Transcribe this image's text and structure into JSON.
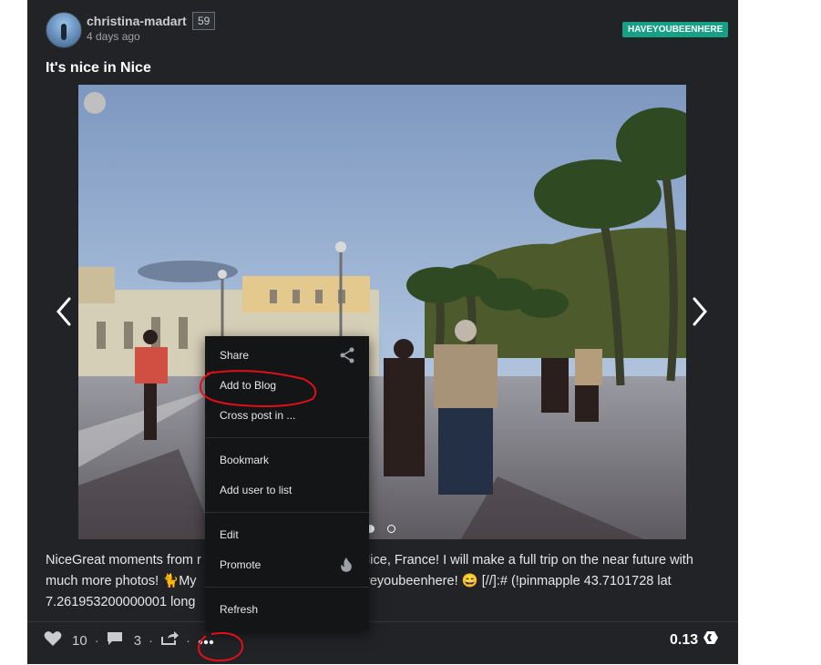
{
  "post": {
    "author": "christina-madart",
    "reputation": "59",
    "timestamp": "4 days ago",
    "tag": "HAVEYOUBEENHERE",
    "title": "It's nice in Nice",
    "body_line1": "NiceGreat moments from r",
    "body_line1_right": "Nice, France! I will make a full trip on the near future with",
    "body_line2": "much more photos! 🐈My",
    "body_line2_right": "aveyoubeenhere! 😄 [//]:# (!pinmapple 43.7101728 lat",
    "body_line3": "7.261953200000001 long"
  },
  "carousel": {
    "slide_count": 2,
    "active_slide": 1
  },
  "footer": {
    "likes": "10",
    "comments": "3",
    "payout": "0.13"
  },
  "menu": {
    "share": "Share",
    "add_to_blog": "Add to Blog",
    "cross_post": "Cross post in ...",
    "bookmark": "Bookmark",
    "add_user_to_list": "Add user to list",
    "edit": "Edit",
    "promote": "Promote",
    "refresh": "Refresh"
  },
  "colors": {
    "card_bg": "#212326",
    "tag_bg": "#16a085",
    "menu_bg": "#141517",
    "annotation": "#e0101a"
  },
  "icons": [
    "share-icon",
    "fire-icon",
    "heart-icon",
    "comment-icon",
    "reblog-icon",
    "more-icon",
    "hive-icon",
    "chevron-left-icon",
    "chevron-right-icon"
  ]
}
